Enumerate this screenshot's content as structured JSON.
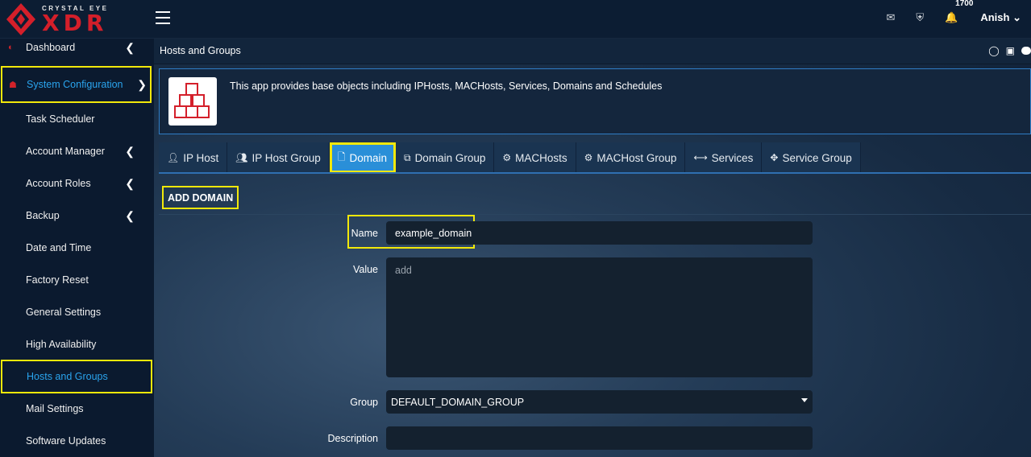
{
  "brand": {
    "small_text": "CRYSTAL EYE",
    "big_text": "XDR",
    "accent": "#d41f2a"
  },
  "topbar": {
    "notification_count": "1700",
    "user_name": "Anish",
    "icons": [
      "envelope-icon",
      "shield-icon",
      "bell-icon"
    ]
  },
  "sidebar": {
    "items": [
      {
        "label": "Dashboard"
      },
      {
        "label": "System Configuration"
      },
      {
        "label": "Task Scheduler"
      },
      {
        "label": "Account Manager"
      },
      {
        "label": "Account Roles"
      },
      {
        "label": "Backup"
      },
      {
        "label": "Date and Time"
      },
      {
        "label": "Factory Reset"
      },
      {
        "label": "General Settings"
      },
      {
        "label": "High Availability"
      },
      {
        "label": "Hosts and Groups"
      },
      {
        "label": "Mail Settings"
      },
      {
        "label": "Software Updates"
      }
    ],
    "highlight_color": "#f2e80a",
    "active_color": "#2aa4ee"
  },
  "content": {
    "title": "Hosts and Groups",
    "info_text": "This app provides base objects including IPHosts, MACHosts, Services, Domains and Schedules"
  },
  "tabs": [
    {
      "label": "IP Host"
    },
    {
      "label": "IP Host Group"
    },
    {
      "label": "Domain"
    },
    {
      "label": "Domain Group"
    },
    {
      "label": "MACHosts"
    },
    {
      "label": "MACHost Group"
    },
    {
      "label": "Services"
    },
    {
      "label": "Service Group"
    }
  ],
  "form": {
    "title": "ADD DOMAIN",
    "name_label": "Name",
    "name_value": "example_domain",
    "value_label": "Value",
    "value_placeholder": "add",
    "group_label": "Group",
    "group_value": "DEFAULT_DOMAIN_GROUP",
    "description_label": "Description",
    "description_value": ""
  }
}
